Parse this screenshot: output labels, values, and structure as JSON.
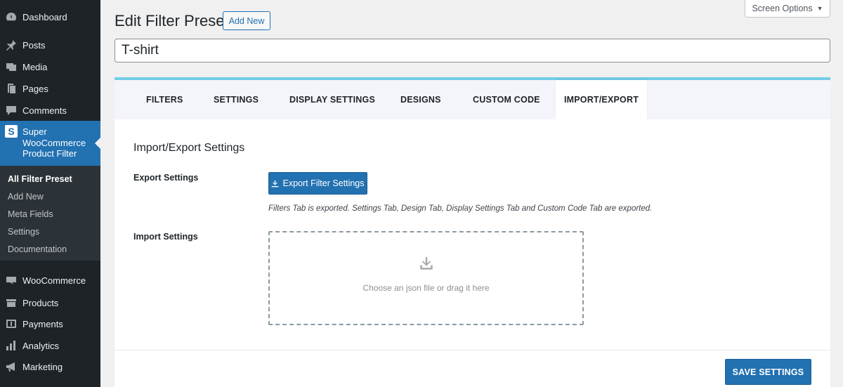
{
  "sidebar": {
    "items_top": [
      {
        "label": "Dashboard",
        "icon": "dashboard-icon"
      },
      {
        "label": "Posts",
        "icon": "pin-icon"
      },
      {
        "label": "Media",
        "icon": "media-icon"
      },
      {
        "label": "Pages",
        "icon": "pages-icon"
      },
      {
        "label": "Comments",
        "icon": "comment-icon"
      }
    ],
    "active": {
      "label": "Super WooCommerce Product Filter",
      "icon_glyph": "S"
    },
    "submenu": [
      {
        "label": "All Filter Preset"
      },
      {
        "label": "Add New"
      },
      {
        "label": "Meta Fields"
      },
      {
        "label": "Settings"
      },
      {
        "label": "Documentation"
      }
    ],
    "items_bottom": [
      {
        "label": "WooCommerce",
        "icon": "woo-icon"
      },
      {
        "label": "Products",
        "icon": "products-icon"
      },
      {
        "label": "Payments",
        "icon": "payments-icon"
      },
      {
        "label": "Analytics",
        "icon": "analytics-icon"
      },
      {
        "label": "Marketing",
        "icon": "megaphone-icon"
      }
    ]
  },
  "header": {
    "title": "Edit Filter Preset",
    "add_new_label": "Add New",
    "screen_options_label": "Screen Options",
    "screen_options_caret": "▼",
    "title_value": "T-shirt"
  },
  "tabs": [
    {
      "label": "FILTERS"
    },
    {
      "label": "SETTINGS"
    },
    {
      "label": "DISPLAY SETTINGS"
    },
    {
      "label": "DESIGNS"
    },
    {
      "label": "CUSTOM CODE"
    },
    {
      "label": "IMPORT/EXPORT",
      "active": true
    }
  ],
  "content": {
    "section_title": "Import/Export Settings",
    "export_label": "Export Settings",
    "export_button_label": "Export Filter Settings",
    "export_note": "Filters Tab is exported. Settings Tab, Design Tab, Display Settings Tab and Custom Code Tab are exported.",
    "import_label": "Import Settings",
    "dropzone_text": "Choose an json file or drag it here",
    "save_button_label": "SAVE SETTINGS"
  },
  "colors": {
    "sidebar_bg": "#1d2327",
    "accent": "#2271b1",
    "tab_border": "#72cde6"
  }
}
